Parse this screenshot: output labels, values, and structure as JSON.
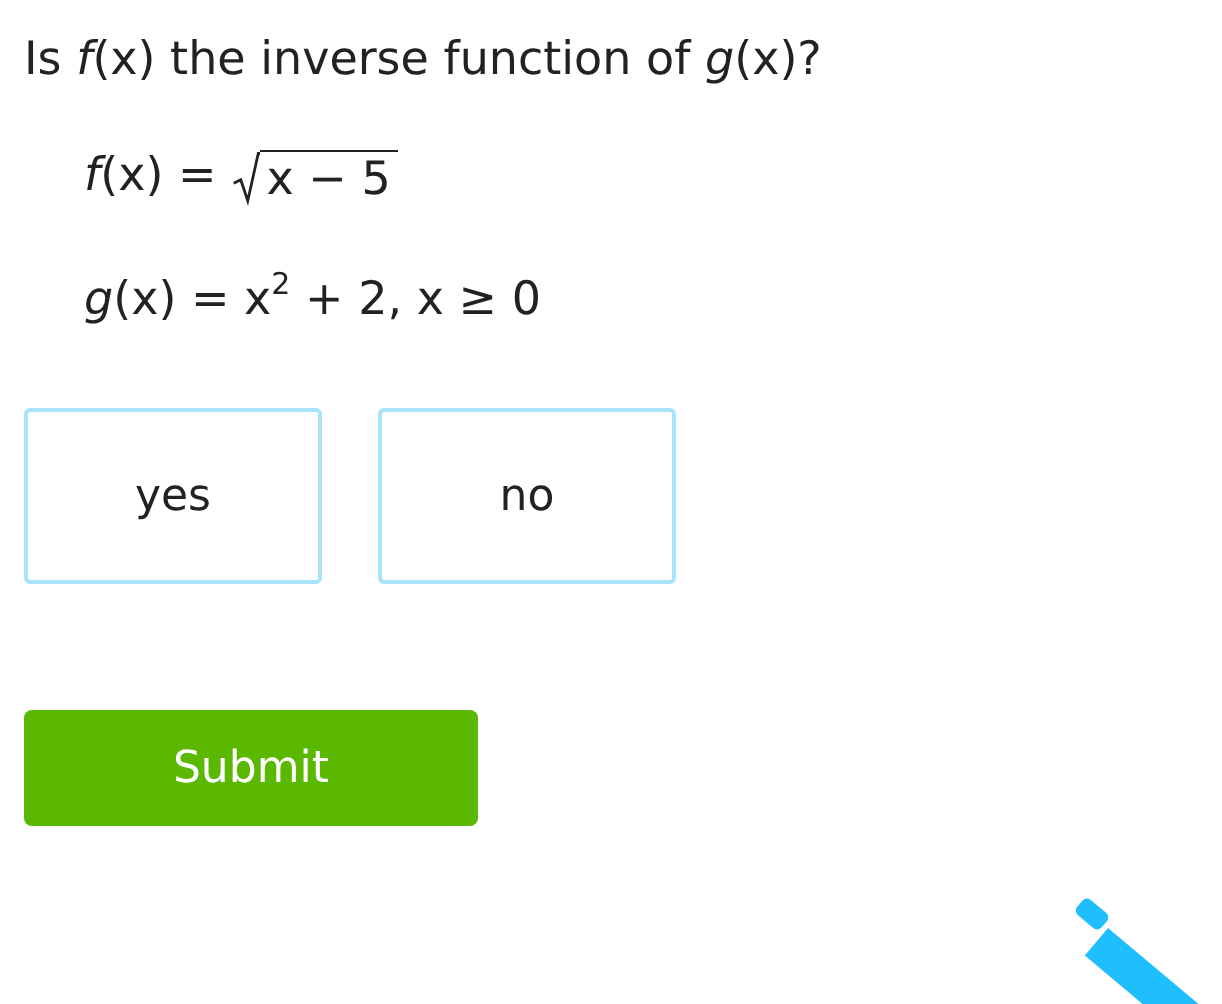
{
  "question": "Is *f*(x) the inverse function of *g*(x)?",
  "equations": [
    {
      "kind": "sqrt",
      "lhs": "*f*(x) =",
      "radicand": "x − 5"
    },
    {
      "kind": "plain",
      "text": "*g*(x) = x$^{2}$ + 2, x ≥ 0"
    }
  ],
  "choices": [
    {
      "label": "yes",
      "selected": false
    },
    {
      "label": "no",
      "selected": false
    }
  ],
  "submit": {
    "label": "Submit"
  }
}
